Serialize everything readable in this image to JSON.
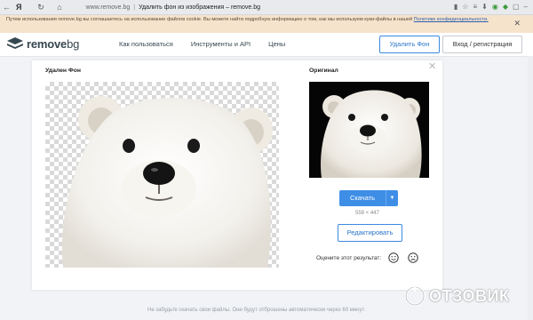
{
  "browser": {
    "brand": "Я",
    "url": "www.remove.bg",
    "page_title": "Удалить фон из изображения – remove.bg"
  },
  "cookie": {
    "text": "Путем использования remove.bg вы соглашаетесь на использование файлов cookie. Вы можете найти подробную информацию о том, как мы используем куки-файлы в нашей ",
    "link": "Политике конфиденциальности."
  },
  "header": {
    "logo_main": "remove",
    "logo_suffix": "bg",
    "menu": [
      "Как пользоваться",
      "Инструменты и API",
      "Цены"
    ],
    "remove_button": "Удалить Фон",
    "login_button": "Вход / регистрация"
  },
  "card": {
    "left_label": "Удален Фон",
    "right_label": "Оригинал",
    "download": "Скачать",
    "dims": "559 × 447",
    "edit": "Редактировать",
    "rate": "Оцените этот результат:"
  },
  "footer": {
    "note": "Не забудьте скачать свои файлы. Они будут отброшены автоматически через 60 минут."
  },
  "watermark": {
    "text": "ОТЗОВИК"
  },
  "colors": {
    "accent": "#3f8ee6",
    "cookie_bg": "#f6e3cc",
    "logo": "#37474f"
  }
}
